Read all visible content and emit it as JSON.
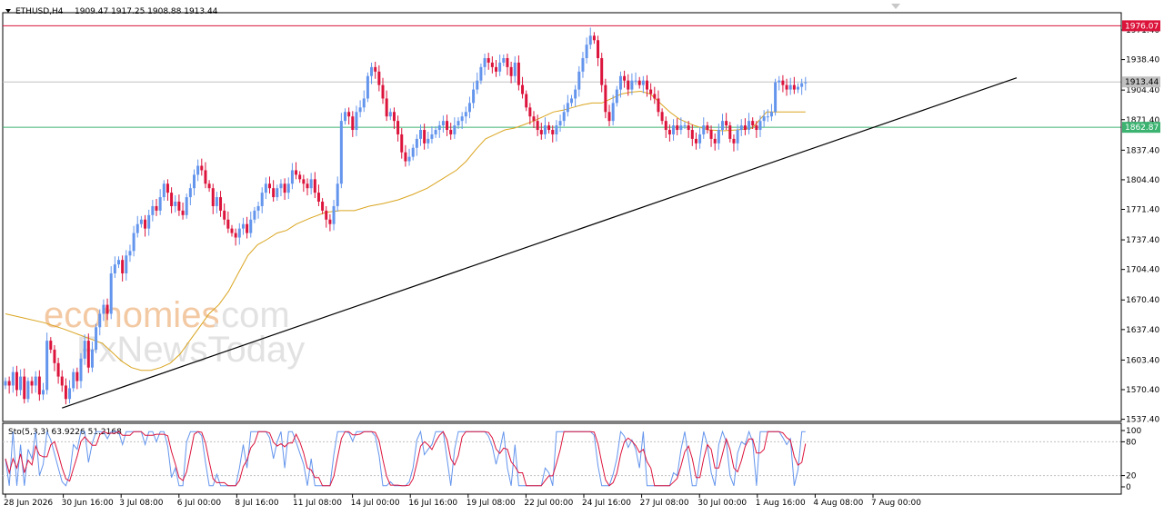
{
  "chart_data": {
    "type": "candlestick",
    "header": {
      "symbol": "ETHUSD,H4",
      "ohlc": "1909.47 1917.25 1908.88 1913.44"
    },
    "price_axis": {
      "ticks": [
        "1971.40",
        "1938.40",
        "1904.40",
        "1871.40",
        "1837.40",
        "1804.40",
        "1771.40",
        "1737.40",
        "1704.40",
        "1670.40",
        "1637.40",
        "1603.40",
        "1570.40",
        "1537.40"
      ],
      "ylim": [
        1537.4,
        1980
      ]
    },
    "time_axis": {
      "labels": [
        "28 Jun 2026",
        "30 Jun 16:00",
        "3 Jul 08:00",
        "6 Jul 00:00",
        "8 Jul 16:00",
        "11 Jul 08:00",
        "14 Jul 00:00",
        "16 Jul 16:00",
        "19 Jul 08:00",
        "22 Jul 00:00",
        "24 Jul 16:00",
        "27 Jul 08:00",
        "30 Jul 00:00",
        "1 Aug 16:00",
        "4 Aug 08:00",
        "7 Aug 00:00"
      ]
    },
    "price_labels": {
      "resistance": {
        "value": 1976.07,
        "text": "1976.07",
        "color": "#dc143c"
      },
      "current": {
        "value": 1913.44,
        "text": "1913.44",
        "color": "#c0c0c0"
      },
      "support": {
        "value": 1862.87,
        "text": "1862.87",
        "color": "#3cb371"
      }
    },
    "trendline": {
      "from": [
        0,
        1550
      ],
      "to": [
        233,
        1918
      ]
    },
    "colors": {
      "bull": "#6495ed",
      "bear": "#dc143c",
      "ma": "#daa520",
      "trendline": "#000000"
    },
    "closes": [
      1580,
      1575,
      1590,
      1570,
      1585,
      1560,
      1580,
      1575,
      1585,
      1565,
      1570,
      1625,
      1615,
      1600,
      1585,
      1575,
      1560,
      1572,
      1590,
      1580,
      1605,
      1625,
      1595,
      1615,
      1640,
      1655,
      1665,
      1655,
      1700,
      1710,
      1715,
      1700,
      1720,
      1725,
      1745,
      1755,
      1760,
      1750,
      1765,
      1775,
      1770,
      1785,
      1800,
      1790,
      1775,
      1780,
      1770,
      1765,
      1785,
      1795,
      1810,
      1820,
      1815,
      1800,
      1795,
      1775,
      1785,
      1770,
      1760,
      1750,
      1745,
      1740,
      1750,
      1755,
      1745,
      1760,
      1770,
      1775,
      1790,
      1800,
      1795,
      1785,
      1795,
      1800,
      1790,
      1800,
      1815,
      1810,
      1805,
      1800,
      1795,
      1805,
      1790,
      1780,
      1770,
      1760,
      1755,
      1775,
      1800,
      1870,
      1880,
      1875,
      1860,
      1880,
      1885,
      1895,
      1920,
      1930,
      1925,
      1910,
      1895,
      1875,
      1880,
      1870,
      1855,
      1835,
      1825,
      1830,
      1840,
      1850,
      1860,
      1845,
      1850,
      1855,
      1860,
      1865,
      1870,
      1860,
      1855,
      1865,
      1870,
      1875,
      1880,
      1890,
      1905,
      1915,
      1930,
      1940,
      1935,
      1930,
      1925,
      1935,
      1940,
      1930,
      1920,
      1935,
      1910,
      1900,
      1885,
      1875,
      1870,
      1860,
      1855,
      1865,
      1860,
      1855,
      1865,
      1870,
      1880,
      1890,
      1895,
      1905,
      1925,
      1940,
      1955,
      1965,
      1960,
      1940,
      1910,
      1880,
      1870,
      1890,
      1905,
      1920,
      1915,
      1905,
      1915,
      1915,
      1910,
      1915,
      1905,
      1900,
      1895,
      1880,
      1870,
      1860,
      1855,
      1865,
      1860,
      1865,
      1865,
      1860,
      1850,
      1845,
      1855,
      1865,
      1860,
      1850,
      1845,
      1860,
      1870,
      1865,
      1850,
      1845,
      1860,
      1865,
      1860,
      1870,
      1865,
      1860,
      1870,
      1875,
      1875,
      1880,
      1913,
      1915,
      1910,
      1905,
      1910,
      1905,
      1908,
      1912,
      1913
    ],
    "ma_start": [
      0,
      1655
    ],
    "ma": [
      1655,
      1650,
      1645,
      1638,
      1630,
      1622,
      1612,
      1602,
      1595,
      1592,
      1592,
      1595,
      1600,
      1610,
      1625,
      1640,
      1655,
      1665,
      1680,
      1700,
      1720,
      1732,
      1738,
      1745,
      1748,
      1755,
      1762,
      1768,
      1770,
      1770,
      1775,
      1778,
      1782,
      1788,
      1795,
      1805,
      1815,
      1825,
      1838,
      1850,
      1855,
      1860,
      1862,
      1866,
      1870,
      1875,
      1880,
      1882,
      1885,
      1888,
      1890,
      1890,
      1895,
      1900,
      1902,
      1903,
      1900,
      1890,
      1880,
      1872,
      1865,
      1860,
      1859,
      1860,
      1862,
      1880,
      1880
    ],
    "ma_x": [
      0,
      8,
      16,
      24,
      32,
      40,
      44,
      48,
      52,
      56,
      60,
      64,
      68,
      72,
      76,
      80,
      84,
      88,
      92,
      96,
      100,
      104,
      108,
      112,
      116,
      120,
      126,
      132,
      138,
      144,
      150,
      156,
      162,
      168,
      174,
      180,
      186,
      190,
      194,
      198,
      202,
      206,
      210,
      214,
      218,
      222,
      226,
      230,
      234,
      238,
      242,
      246,
      250,
      254,
      258,
      262,
      266,
      270,
      274,
      278,
      284,
      290,
      296,
      302,
      308,
      314,
      330
    ],
    "stochastic": {
      "label": "Sto(5,3,3) 63.9226 51.2168",
      "ticks": [
        "100",
        "80",
        "20",
        "0"
      ],
      "levels": [
        80,
        20
      ]
    }
  }
}
